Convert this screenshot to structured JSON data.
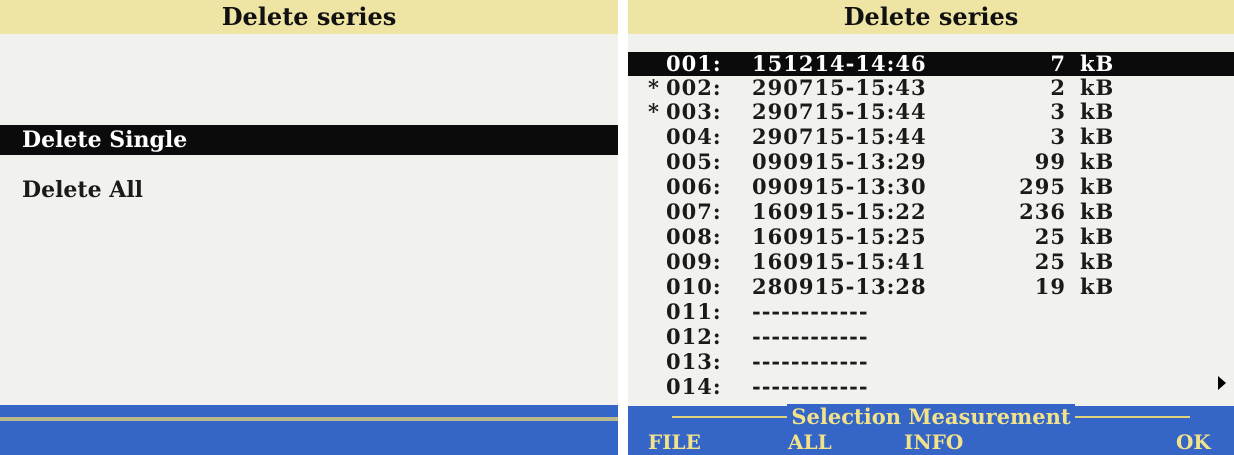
{
  "left_screen": {
    "title": "Delete series",
    "menu_items": [
      {
        "label": "Delete Single",
        "selected": true
      },
      {
        "label": "Delete All",
        "selected": false
      }
    ]
  },
  "right_screen": {
    "title": "Delete series",
    "rows": [
      {
        "marker": "",
        "number": "001:",
        "date": "151214-14:46",
        "size": "7",
        "unit": "kB",
        "selected": true
      },
      {
        "marker": "*",
        "number": "002:",
        "date": "290715-15:43",
        "size": "2",
        "unit": "kB"
      },
      {
        "marker": "*",
        "number": "003:",
        "date": "290715-15:44",
        "size": "3",
        "unit": "kB"
      },
      {
        "marker": "",
        "number": "004:",
        "date": "290715-15:44",
        "size": "3",
        "unit": "kB"
      },
      {
        "marker": "",
        "number": "005:",
        "date": "090915-13:29",
        "size": "99",
        "unit": "kB"
      },
      {
        "marker": "",
        "number": "006:",
        "date": "090915-13:30",
        "size": "295",
        "unit": "kB"
      },
      {
        "marker": "",
        "number": "007:",
        "date": "160915-15:22",
        "size": "236",
        "unit": "kB"
      },
      {
        "marker": "",
        "number": "008:",
        "date": "160915-15:25",
        "size": "25",
        "unit": "kB"
      },
      {
        "marker": "",
        "number": "009:",
        "date": "160915-15:41",
        "size": "25",
        "unit": "kB"
      },
      {
        "marker": "",
        "number": "010:",
        "date": "280915-13:28",
        "size": "19",
        "unit": "kB"
      },
      {
        "marker": "",
        "number": "011:",
        "date": "------------",
        "size": "",
        "unit": ""
      },
      {
        "marker": "",
        "number": "012:",
        "date": "------------",
        "size": "",
        "unit": ""
      },
      {
        "marker": "",
        "number": "013:",
        "date": "------------",
        "size": "",
        "unit": ""
      },
      {
        "marker": "",
        "number": "014:",
        "date": "------------",
        "size": "",
        "unit": ""
      }
    ],
    "scroll_icon": "triangle-right-icon",
    "selection_label": "Selection Measurement",
    "softkeys": {
      "file": "FILE",
      "all": "ALL",
      "info": "INFO",
      "ok": "OK"
    }
  },
  "colors": {
    "title_bar": "#eee4a3",
    "screen_bg": "#f1f1ee",
    "highlight": "#0b0b0b",
    "bottom_bar": "#3465c7",
    "softkey_text": "#f2e28a"
  }
}
